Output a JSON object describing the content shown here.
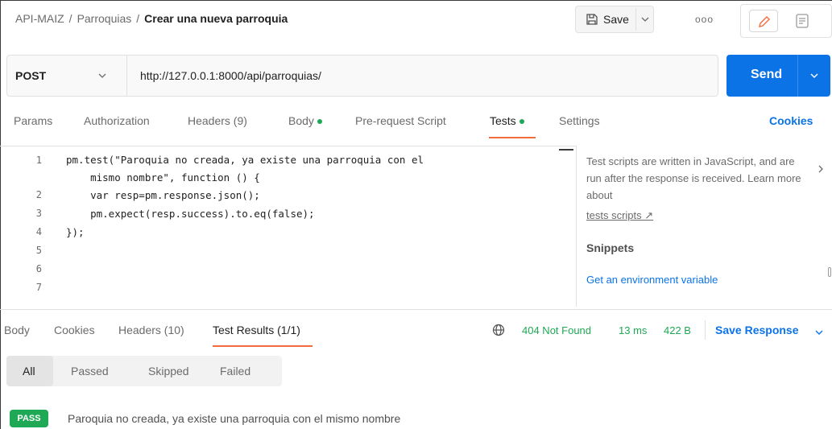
{
  "breadcrumb": {
    "collection": "API-MAIZ",
    "separator": "/",
    "folder": "Parroquias",
    "request": "Crear una nueva parroquia"
  },
  "toolbar": {
    "save_label": "Save",
    "more_label": "ooo"
  },
  "request": {
    "method": "POST",
    "url": "http://127.0.0.1:8000/api/parroquias/",
    "send_label": "Send"
  },
  "request_tabs": [
    {
      "label": "Params"
    },
    {
      "label": "Authorization"
    },
    {
      "label": "Headers (9)"
    },
    {
      "label": "Body"
    },
    {
      "label": "Pre-request Script"
    },
    {
      "label": "Tests"
    },
    {
      "label": "Settings"
    }
  ],
  "cookies_label": "Cookies",
  "editor": {
    "line_numbers": [
      "1",
      "",
      "2",
      "3",
      "4",
      "5",
      "6",
      "7"
    ],
    "lines": [
      "pm.test(\"Paroquia no creada, ya existe una parroquia con el",
      "    mismo nombre\", function () {",
      "    var resp=pm.response.json();",
      "    pm.expect(resp.success).to.eq(false);",
      "});"
    ]
  },
  "info_panel": {
    "text": "Test scripts are written in JavaScript, and are run after the response is received. Learn more about",
    "link": "tests scripts ↗",
    "snippets_title": "Snippets",
    "snippet_item": "Get an environment variable"
  },
  "response_tabs": [
    {
      "label": "Body"
    },
    {
      "label": "Cookies"
    },
    {
      "label": "Headers (10)"
    },
    {
      "label": "Test Results (1/1)"
    }
  ],
  "response_meta": {
    "status": "404 Not Found",
    "time": "13 ms",
    "size": "422 B",
    "save_response_label": "Save Response"
  },
  "filters": [
    "All",
    "Passed",
    "Skipped",
    "Failed"
  ],
  "result": {
    "badge": "PASS",
    "text": "Paroquia no creada, ya existe una parroquia con el mismo nombre"
  },
  "colors": {
    "accent": "#f26b3a",
    "send_blue": "#0b73e6",
    "success_green": "#1fa855"
  }
}
